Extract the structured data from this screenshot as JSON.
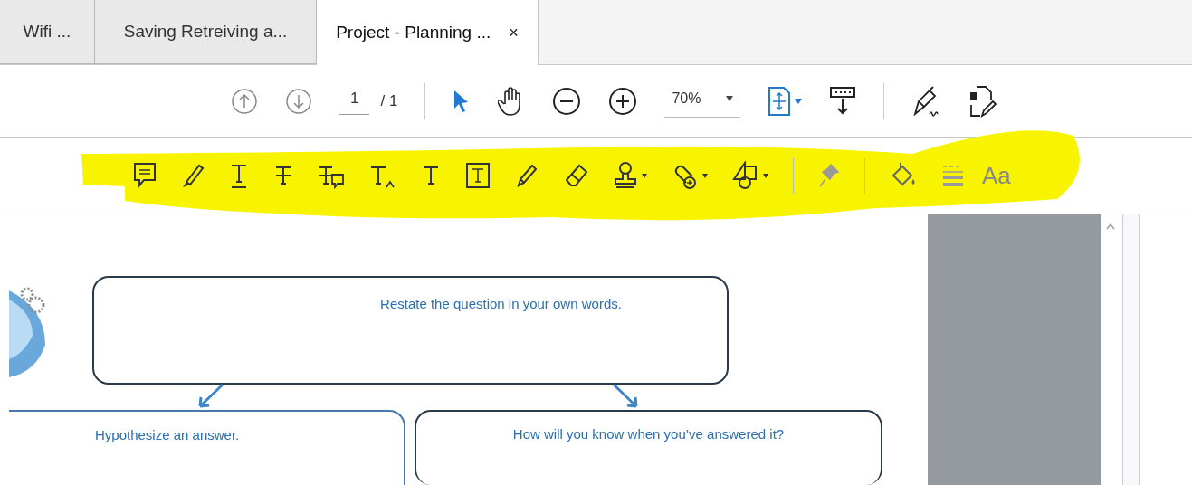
{
  "tabs": [
    {
      "label": "Wifi ...",
      "selected": false
    },
    {
      "label": "Saving Retreiving a...",
      "selected": false
    },
    {
      "label": "Project - Planning ...",
      "selected": true,
      "close": "×"
    }
  ],
  "navigation_toolbar": {
    "page_number": "1",
    "page_total": "/ 1",
    "zoom": "70%"
  },
  "annotation_toolbar": {
    "text_style_label": "Aa"
  },
  "document": {
    "boxes": [
      {
        "text": "Restate the question in your own words."
      },
      {
        "text": "Hypothesize an answer."
      },
      {
        "text": "How will you know when you’ve answered it?"
      }
    ]
  }
}
